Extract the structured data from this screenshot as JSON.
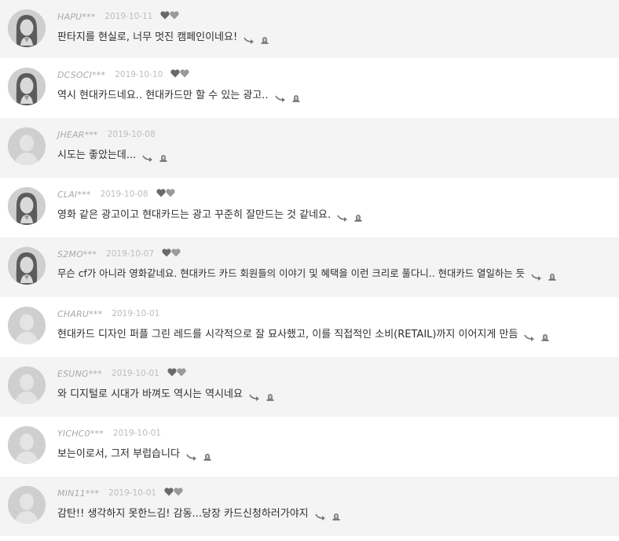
{
  "comments": [
    {
      "user": "HAPU***",
      "date": "2019-10-11",
      "avatar": "female",
      "text": "판타지를 현실로, 너무 멋진 캠페인이네요!"
    },
    {
      "user": "DCSOCI***",
      "date": "2019-10-10",
      "avatar": "female",
      "text": "역시 현대카드네요.. 현대카드만 할 수 있는 광고.."
    },
    {
      "user": "JHEAR***",
      "date": "2019-10-08",
      "avatar": "neutral",
      "text": "시도는 좋았는데..."
    },
    {
      "user": "CLAI***",
      "date": "2019-10-08",
      "avatar": "female",
      "text": "영화 같은 광고이고 현대카드는 광고 꾸준히 잘만드는 것 같네요."
    },
    {
      "user": "S2MO***",
      "date": "2019-10-07",
      "avatar": "female",
      "text": "무슨 cf가 아니라 영화같네요. 현대카드 카드 회원들의 이야기 및 혜택을 이런 크리로 풀다니.. 현대카드 열일하는 듯"
    },
    {
      "user": "CHARU***",
      "date": "2019-10-01",
      "avatar": "neutral",
      "text": "현대카드 디자인 퍼플 그린 레드를 시각적으로 잘 묘사했고, 이를 직접적인 소비(RETAIL)까지 이어지게 만듬"
    },
    {
      "user": "ESUNG***",
      "date": "2019-10-01",
      "avatar": "neutral",
      "text": "와 디지털로 시대가 바껴도 역시는 역시네요"
    },
    {
      "user": "YICHC0***",
      "date": "2019-10-01",
      "avatar": "neutral",
      "text": "보는이로서, 그저 부럽습니다"
    },
    {
      "user": "MIN11***",
      "date": "2019-10-01",
      "avatar": "neutral",
      "text": "감탄!! 생각하지 못한느김! 감동...당장 카드신청하러가야지"
    }
  ],
  "icons": {
    "like": "heart-icon",
    "reply": "reply-arrow-icon",
    "report": "report-siren-icon"
  },
  "colors": {
    "alt_row": "#f4f4f4",
    "meta_text": "#a9a9a9",
    "heart_dark": "#6a6a6a",
    "heart_light": "#9a9a9a"
  }
}
